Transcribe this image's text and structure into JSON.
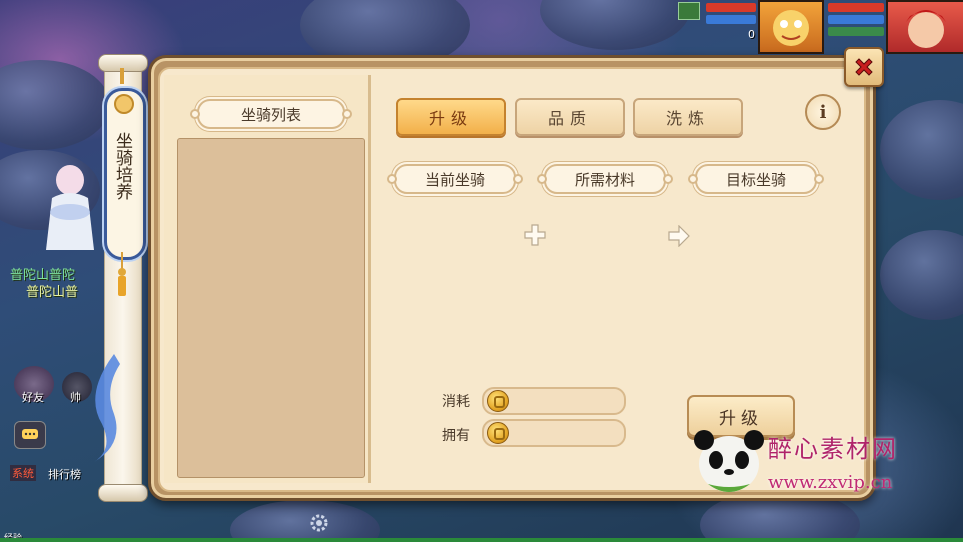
{
  "scene": {
    "map_name_1": "普陀山普陀",
    "map_name_2": "普陀山普",
    "friend_label": "好友",
    "partner_label": "帅",
    "system_tag": "系统",
    "ranking_label": "排行榜",
    "chat_icon": "chat-bubble-icon",
    "zero_label": "0",
    "bottom_tag": "经验"
  },
  "side_scroll": {
    "title": "坐骑培养"
  },
  "left_list": {
    "header": "坐骑列表"
  },
  "tabs": [
    {
      "label": "升级",
      "active": true
    },
    {
      "label": "品质",
      "active": false
    },
    {
      "label": "洗炼",
      "active": false
    }
  ],
  "info_button": "i",
  "slots": {
    "current": "当前坐骑",
    "material": "所需材料",
    "target": "目标坐骑"
  },
  "cost": {
    "consume_label": "消耗",
    "own_label": "拥有",
    "consume_value": "",
    "own_value": ""
  },
  "upgrade_button": "升级",
  "watermark": {
    "title": "醉心素材网",
    "url": "www.zxvip.cn"
  },
  "colors": {
    "accent": "#f2b04a",
    "close_x": "#c81e1e",
    "panel": "#f7e8cc"
  }
}
